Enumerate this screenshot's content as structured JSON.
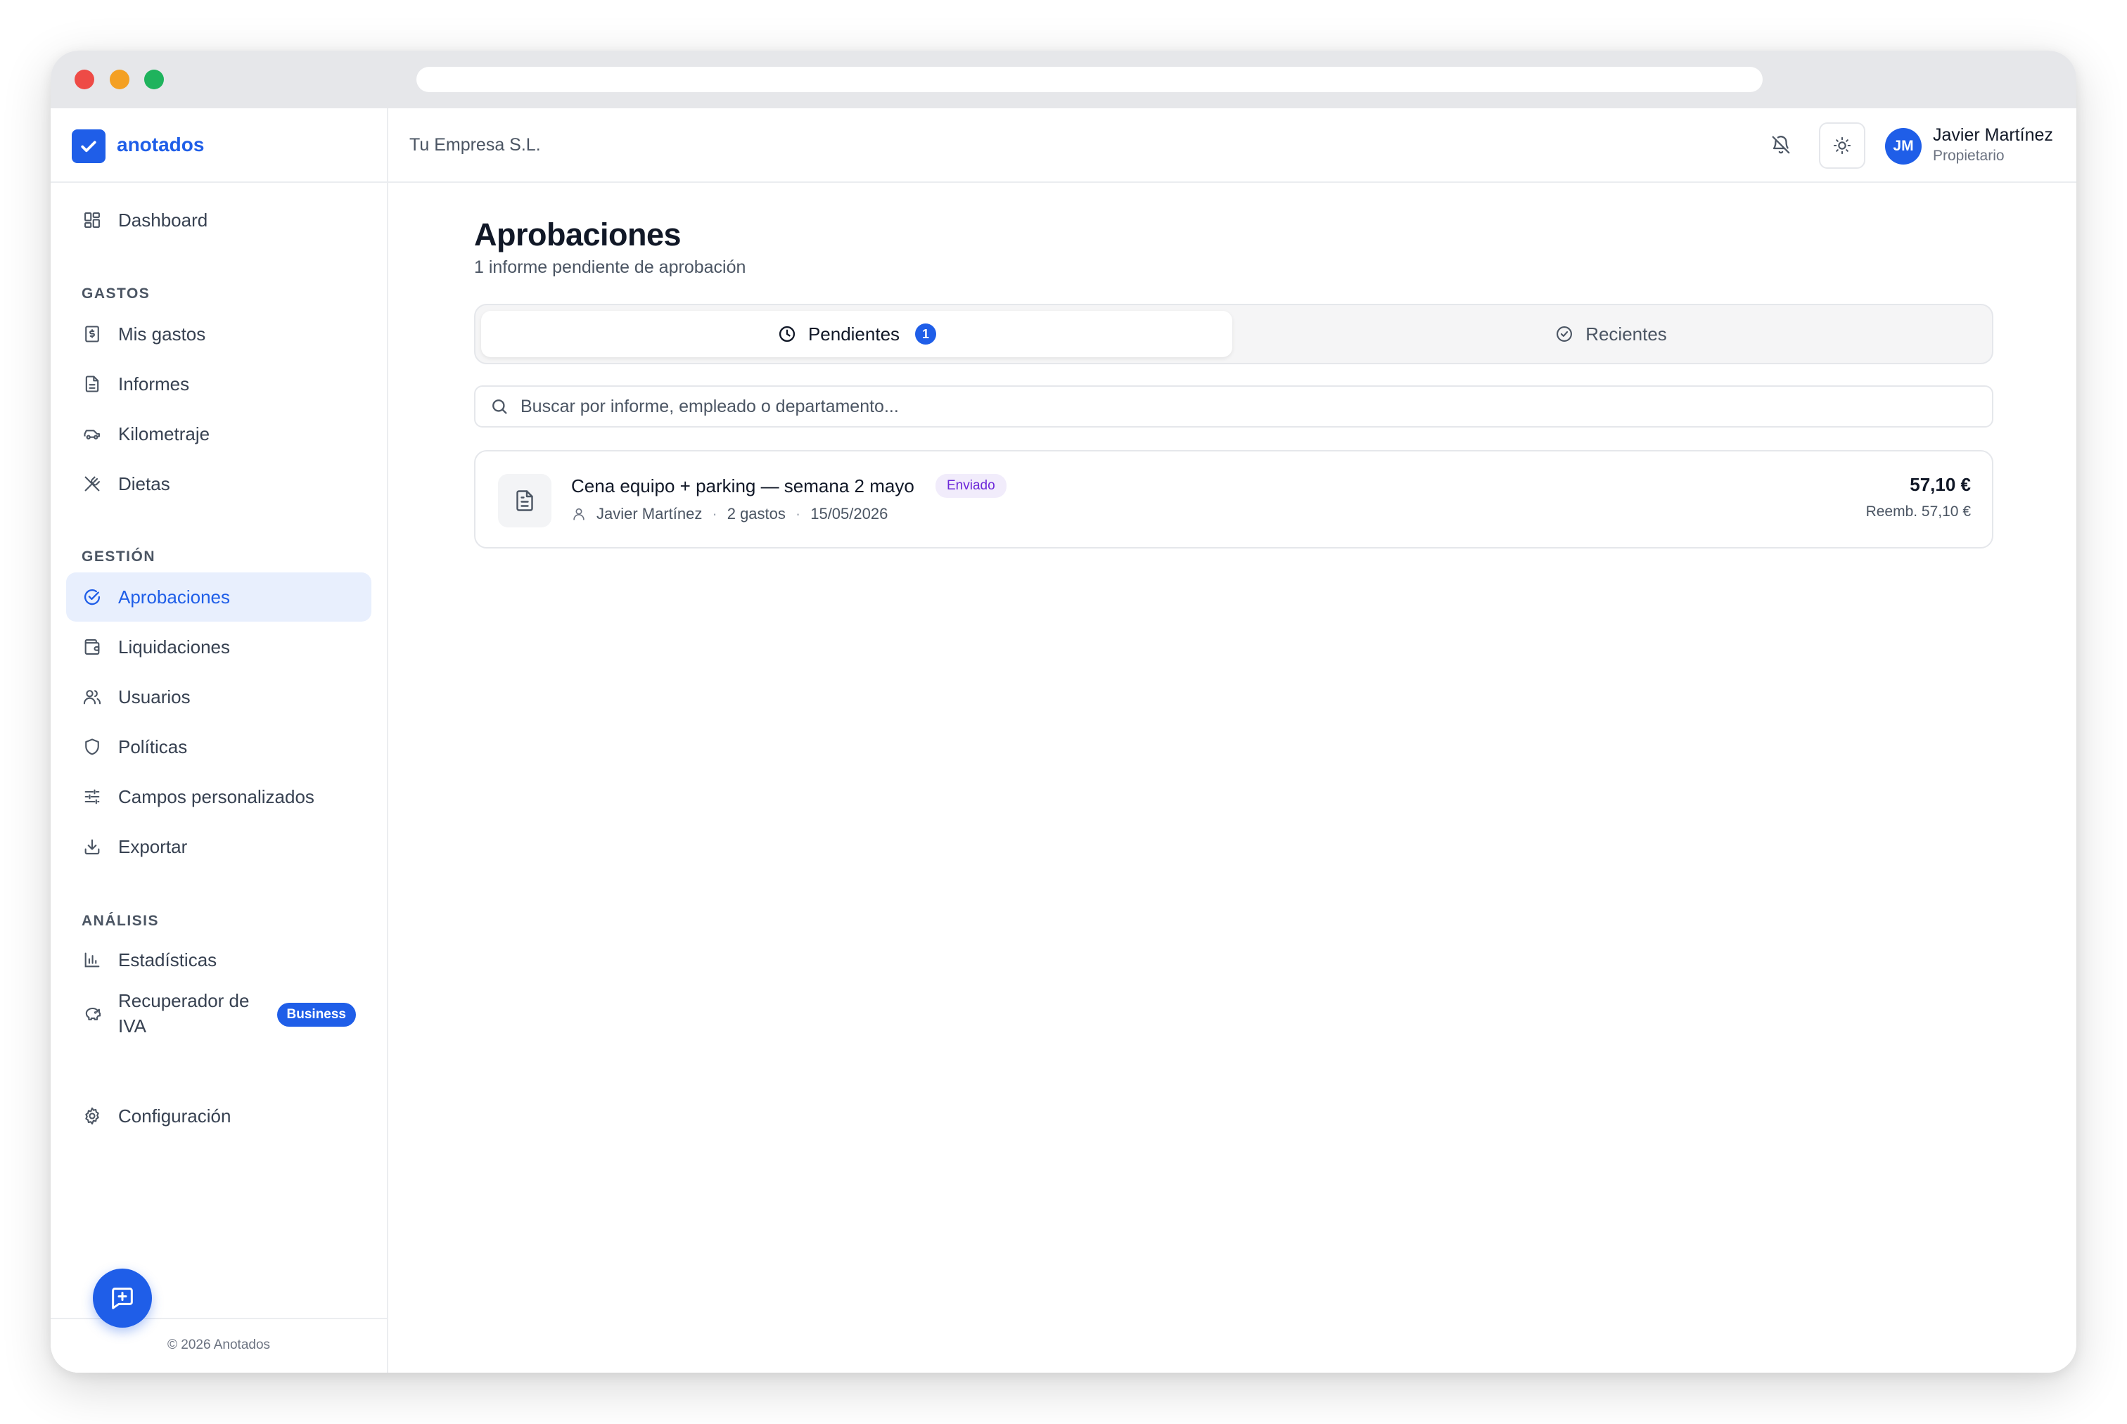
{
  "brand": {
    "name": "anotados"
  },
  "colors": {
    "accent": "#1f5ee8",
    "status_purple": "#6d28d9"
  },
  "sidebar": {
    "dashboard": "Dashboard",
    "sections": {
      "gastos": "GASTOS",
      "gestion": "GESTIÓN",
      "analisis": "ANÁLISIS"
    },
    "items": {
      "mis_gastos": "Mis gastos",
      "informes": "Informes",
      "kilometraje": "Kilometraje",
      "dietas": "Dietas",
      "aprobaciones": "Aprobaciones",
      "liquidaciones": "Liquidaciones",
      "usuarios": "Usuarios",
      "politicas": "Políticas",
      "campos": "Campos personalizados",
      "exportar": "Exportar",
      "estadisticas": "Estadísticas",
      "recuperador": "Recuperador de IVA",
      "recuperador_badge": "Business",
      "configuracion": "Configuración"
    },
    "footer": "© 2026 Anotados"
  },
  "header": {
    "company": "Tu Empresa S.L.",
    "user": {
      "initials": "JM",
      "name": "Javier Martínez",
      "role": "Propietario"
    }
  },
  "main": {
    "title": "Aprobaciones",
    "subtitle": "1 informe pendiente de aprobación",
    "tabs": {
      "pending": {
        "label": "Pendientes",
        "count": "1"
      },
      "recent": {
        "label": "Recientes"
      }
    },
    "search": {
      "placeholder": "Buscar por informe, empleado o departamento...",
      "value": ""
    },
    "reports": [
      {
        "title": "Cena equipo + parking — semana 2 mayo",
        "status": "Enviado",
        "employee": "Javier Martínez",
        "expenses": "2 gastos",
        "date": "15/05/2026",
        "amount": "57,10 €",
        "reimbursement": "Reemb. 57,10 €"
      }
    ]
  }
}
